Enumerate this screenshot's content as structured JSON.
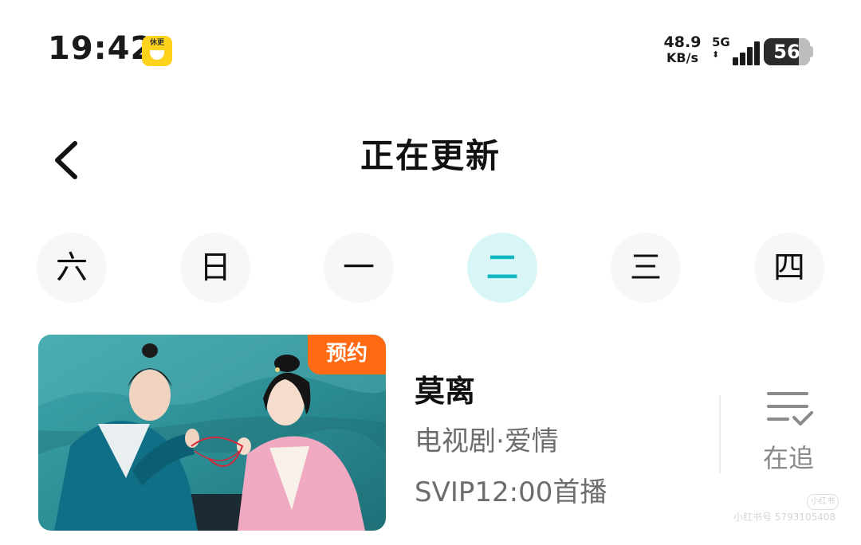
{
  "status_bar": {
    "time": "19:42",
    "app_badge": "休更",
    "net_speed_value": "48.9",
    "net_speed_unit": "KB/s",
    "network": "5G",
    "battery": "56"
  },
  "header": {
    "back_icon": "chevron-left-icon",
    "title": "正在更新"
  },
  "day_tabs": [
    {
      "label": "六",
      "active": false
    },
    {
      "label": "日",
      "active": false
    },
    {
      "label": "一",
      "active": false
    },
    {
      "label": "二",
      "active": true
    },
    {
      "label": "三",
      "active": false
    },
    {
      "label": "四",
      "active": false
    }
  ],
  "shows": [
    {
      "title": "莫离",
      "badge": "预约",
      "genre": "电视剧·爱情",
      "schedule": "SVIP12:00首播",
      "follow_label": "在追",
      "follow_icon": "list-check-icon"
    }
  ],
  "watermark": "小红书号 5793105408",
  "watermark_pill": "小红书",
  "colors": {
    "accent": "#13b8c4",
    "active_tab_bg": "#d9f6f7",
    "badge": "#ff6a13",
    "muted_text": "#6d6d6d"
  }
}
